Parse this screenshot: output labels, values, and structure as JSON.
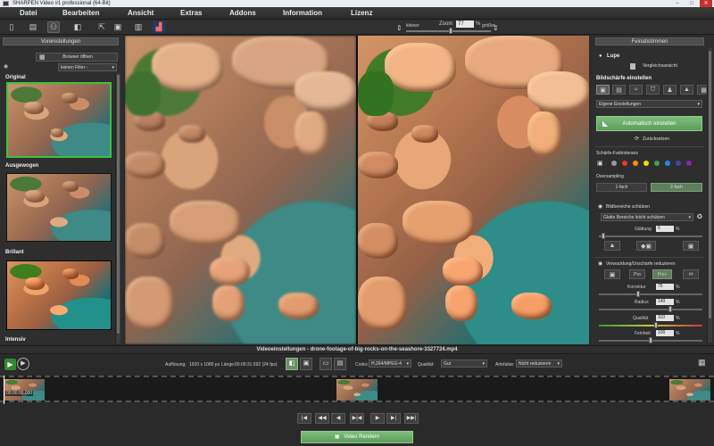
{
  "window": {
    "title": "SHARPEN Video #1 professional (64-Bit)",
    "minimize": "–",
    "maximize": "□",
    "close": "✕"
  },
  "menu": [
    "Datei",
    "Bearbeiten",
    "Ansicht",
    "Extras",
    "Addons",
    "Information",
    "Lizenz"
  ],
  "toolbar": {
    "icons": [
      "new-file-icon",
      "open-file-icon",
      "compare-view-icon",
      "split-view-icon",
      "export-icon",
      "print-icon",
      "film-icon",
      "histogram-icon"
    ],
    "zoom_label": "Zoom",
    "zoom_value": "77",
    "zoom_unit": "%",
    "smaller": "kleiner",
    "larger": "größer"
  },
  "left": {
    "title": "Voreinstellungen",
    "browser_btn": "Browser öffnen",
    "filter": "keinen Filter -",
    "presets": [
      {
        "name": "Original"
      },
      {
        "name": "Ausgewogen"
      },
      {
        "name": "Brillant"
      },
      {
        "name": "Intensiv"
      }
    ]
  },
  "right": {
    "title": "Feinabstimmen",
    "loupe": "Lupe",
    "compare": "Vergleichsansicht",
    "sharp_title": "Bildschärfe einstellen",
    "own_settings": "Eigene Einstellungen",
    "auto_btn": "Automatisch einstellen",
    "reset_btn": "Zurücksetzen",
    "tolerance": "Schärfe-Farbtoleranz",
    "oversampling": "Oversampling",
    "oversampling_options": [
      "1-fach",
      "2-fach"
    ],
    "protect": "Bildbereiche schützen",
    "protect_option": "Glatte Bereiche leicht schützen",
    "smoothing_label": "Glättung",
    "smoothing_value": "5",
    "smoothing_unit": "%",
    "blur_title": "Verwacklung/Unschärfe reduzieren",
    "blur_modes": [
      "Pro",
      "Pro+"
    ],
    "correction_label": "Korrektur",
    "correction_value": "75",
    "correction_unit": "%",
    "radius_label": "Radius",
    "radius_value": "140",
    "radius_unit": "%",
    "quality_label": "Qualität",
    "quality_value": "110",
    "quality_unit": "%",
    "fineness_label": "Feinheit",
    "fineness_value": "100",
    "fineness_unit": "%",
    "tolerance_colors": [
      "#999999",
      "#e53935",
      "#ff8f00",
      "#ffd600",
      "#43a047",
      "#1e88e5",
      "#3949ab",
      "#8e24aa"
    ]
  },
  "video": {
    "settings_title": "Videoeinstellungen - drone-footage-of-big-rocks-on-the-seashore-3327724.mp4",
    "resolution_label": "Auflösung:",
    "resolution": "1920 x 1080 px",
    "length_label": "Länge:",
    "length": "00:00:31.592 (24 fps)",
    "codec_label": "Codec:",
    "codec": "H.264/MPEG-4",
    "quality_label": "Qualität:",
    "quality": "Gut",
    "artifacts_label": "Artefakte:",
    "artifacts": "Nicht reduzieren",
    "timecode": "00:00:00.000",
    "render_btn": "Video Rendern"
  },
  "transport": [
    "|◀",
    "◀◀",
    "◀",
    "▶|◀",
    "▶",
    "▶|",
    "▶▶|"
  ]
}
